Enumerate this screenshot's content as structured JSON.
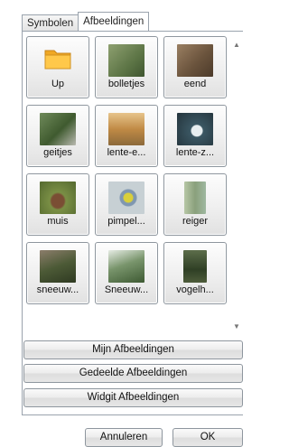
{
  "tabs": [
    {
      "label": "Symbolen",
      "active": false
    },
    {
      "label": "Afbeeldingen",
      "active": true
    }
  ],
  "tiles": [
    {
      "label": "Up",
      "icon": "folder-icon",
      "color": "#f5b73b"
    },
    {
      "label": "bolletjes",
      "icon": "photo-thumbnail",
      "color": "#6f8a58"
    },
    {
      "label": "eend",
      "icon": "photo-thumbnail",
      "color": "#7a6148"
    },
    {
      "label": "geitjes",
      "icon": "photo-thumbnail",
      "color": "#4e6a3f"
    },
    {
      "label": "lente-e...",
      "icon": "photo-thumbnail",
      "color": "#c89a52"
    },
    {
      "label": "lente-z...",
      "icon": "photo-thumbnail",
      "color": "#2f4a56"
    },
    {
      "label": "muis",
      "icon": "photo-thumbnail",
      "color": "#6b7e3c"
    },
    {
      "label": "pimpel...",
      "icon": "photo-thumbnail",
      "color": "#aab6b8"
    },
    {
      "label": "reiger",
      "icon": "photo-thumbnail",
      "color": "#8fa98a"
    },
    {
      "label": "sneeuw...",
      "icon": "photo-thumbnail",
      "color": "#4f5a3c"
    },
    {
      "label": "Sneeuw...",
      "icon": "photo-thumbnail",
      "color": "#5d7a52"
    },
    {
      "label": "vogelh...",
      "icon": "photo-thumbnail",
      "color": "#3e5232"
    }
  ],
  "library_buttons": [
    "Mijn Afbeeldingen",
    "Gedeelde Afbeeldingen",
    "Widgit Afbeeldingen"
  ],
  "dialog": {
    "cancel_label": "Annuleren",
    "ok_label": "OK"
  },
  "scroll": {
    "up_glyph": "▲",
    "down_glyph": "▼"
  }
}
